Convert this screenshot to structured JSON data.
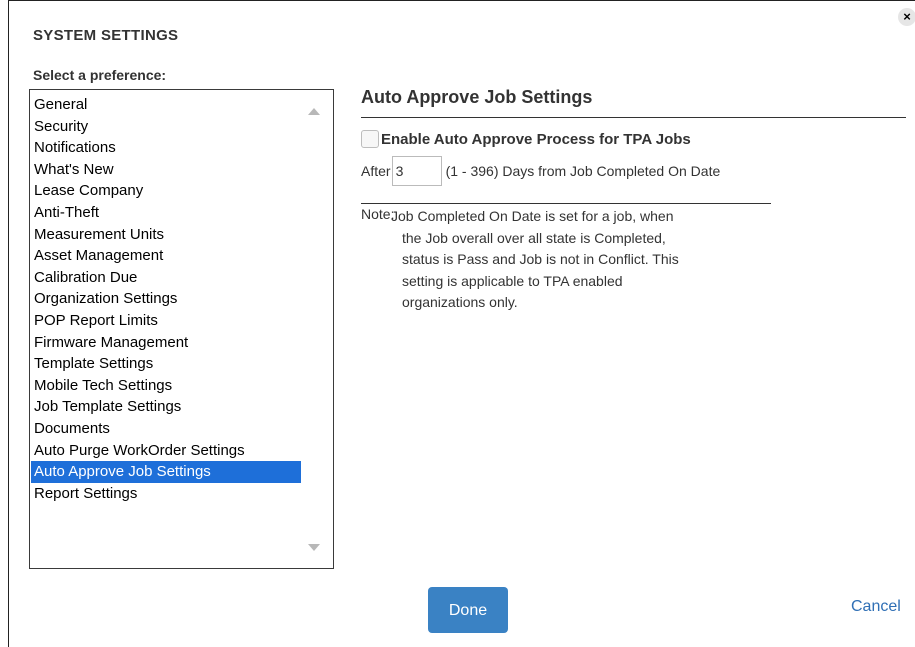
{
  "dialog": {
    "title": "SYSTEM SETTINGS",
    "close_symbol": "×"
  },
  "sidebar": {
    "label": "Select a preference:",
    "items": [
      {
        "label": "General"
      },
      {
        "label": "Security"
      },
      {
        "label": "Notifications"
      },
      {
        "label": "What's New"
      },
      {
        "label": "Lease Company"
      },
      {
        "label": "Anti-Theft"
      },
      {
        "label": "Measurement Units"
      },
      {
        "label": "Asset Management"
      },
      {
        "label": "Calibration Due"
      },
      {
        "label": "Organization Settings"
      },
      {
        "label": "POP Report Limits"
      },
      {
        "label": "Firmware Management"
      },
      {
        "label": "Template Settings"
      },
      {
        "label": "Mobile Tech Settings"
      },
      {
        "label": "Job Template Settings"
      },
      {
        "label": "Documents"
      },
      {
        "label": "Auto Purge WorkOrder Settings"
      },
      {
        "label": "Auto Approve Job Settings",
        "selected": true
      },
      {
        "label": "Report Settings"
      }
    ]
  },
  "main": {
    "section_title": "Auto Approve Job Settings",
    "enable_label": "Enable Auto Approve Process for TPA Jobs",
    "enable_checked": false,
    "after_label": "After",
    "days_value": "3",
    "days_hint": "(1 - 396) Days from Job Completed On Date",
    "note_prefix": "Note:",
    "note_lines": [
      "Job Completed On Date is set for a job, when",
      "the Job overall over all state is Completed,",
      "status is Pass and Job is not in Conflict. This",
      "setting is applicable to TPA enabled",
      "organizations only."
    ]
  },
  "footer": {
    "done_label": "Done",
    "cancel_label": "Cancel"
  },
  "colors": {
    "selected_bg": "#1e6fd9",
    "done_bg": "#3a82c4",
    "link": "#2f6fb5"
  }
}
